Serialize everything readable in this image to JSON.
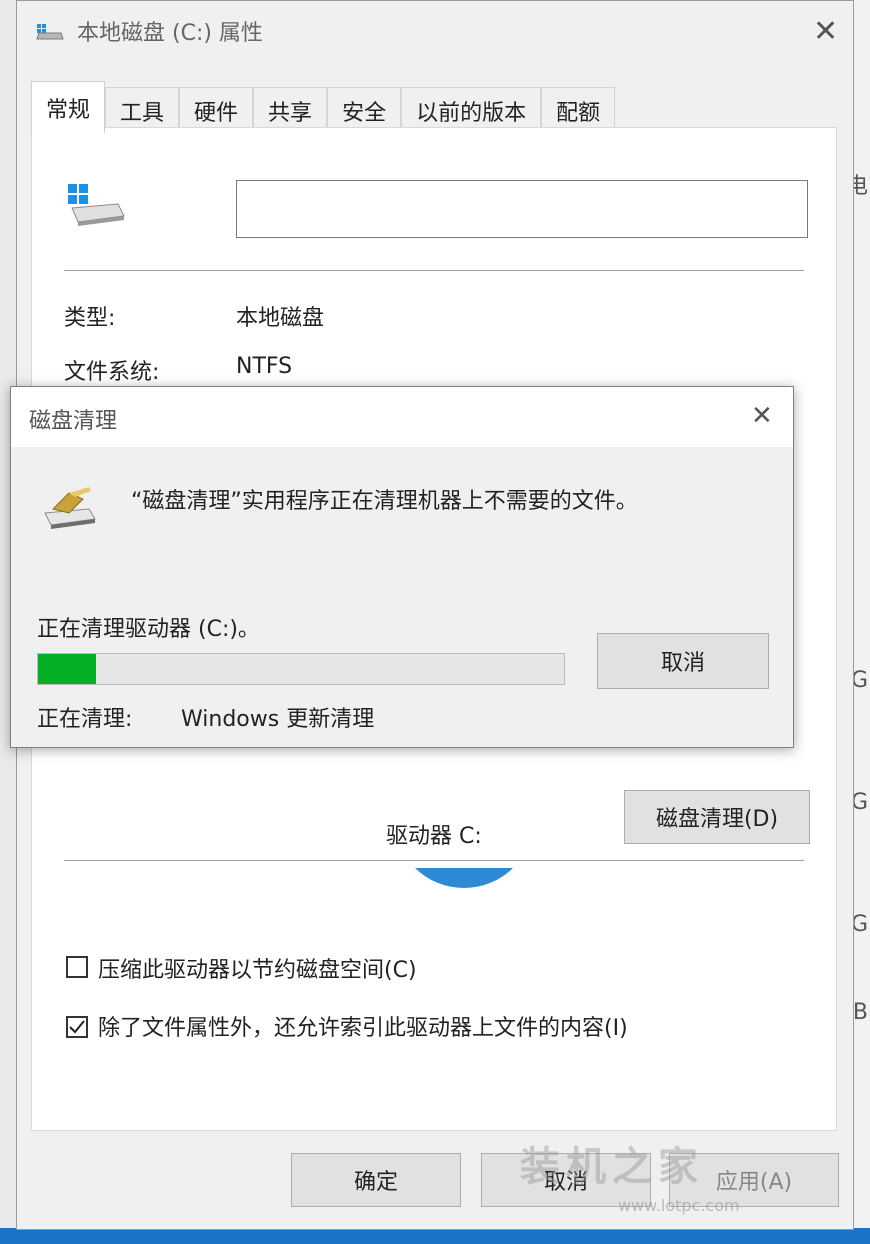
{
  "properties_window": {
    "title": "本地磁盘 (C:) 属性",
    "close_glyph": "✕",
    "tabs": [
      {
        "label": "常规",
        "active": true
      },
      {
        "label": "工具",
        "active": false
      },
      {
        "label": "硬件",
        "active": false
      },
      {
        "label": "共享",
        "active": false
      },
      {
        "label": "安全",
        "active": false
      },
      {
        "label": "以前的版本",
        "active": false
      },
      {
        "label": "配额",
        "active": false
      }
    ],
    "volume_name_value": "",
    "type_label": "类型:",
    "type_value": "本地磁盘",
    "fs_label": "文件系统:",
    "fs_value": "NTFS",
    "drive_label": "驱动器 C:",
    "disk_cleanup_button": "磁盘清理(D)",
    "compress_checkbox": {
      "label": "压缩此驱动器以节约磁盘空间(C)",
      "checked": false
    },
    "index_checkbox": {
      "label": "除了文件属性外，还允许索引此驱动器上文件的内容(I)",
      "checked": true
    },
    "ok_button": "确定",
    "cancel_button": "取消",
    "apply_button": "应用(A)"
  },
  "cleanup_dialog": {
    "title": "磁盘清理",
    "close_glyph": "✕",
    "message": "“磁盘清理”实用程序正在清理机器上不需要的文件。",
    "status": "正在清理驱动器 (C:)。",
    "progress": 0.11,
    "progress_color": "#06b025",
    "cleaning_label": "正在清理:",
    "cleaning_item": "Windows 更新清理",
    "cancel_button": "取消"
  },
  "background_glyphs": {
    "right_g1": "G",
    "right_g2": "G",
    "right_g3": "G",
    "right_b": "B",
    "right_top": "电"
  },
  "watermark": {
    "text": "装机之家",
    "url": "www.lotpc.com"
  },
  "icons": {
    "drive": "windows-drive-icon",
    "cleanup": "disk-cleanup-icon",
    "check": "check-mark-icon"
  }
}
